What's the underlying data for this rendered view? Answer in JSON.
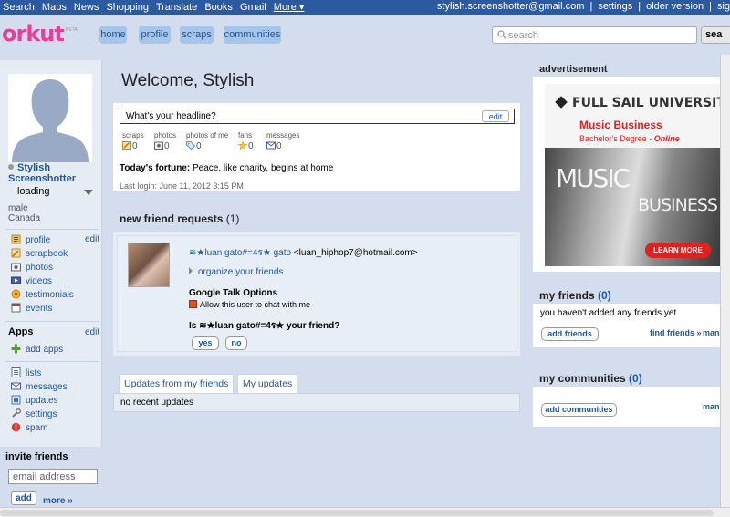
{
  "gbar": {
    "links": [
      "Search",
      "Maps",
      "News",
      "Shopping",
      "Translate",
      "Books",
      "Gmail"
    ],
    "more": "More ▾",
    "email": "stylish.screenshotter@gmail.com",
    "settings": "settings",
    "older_version": "older version",
    "signout": "sig"
  },
  "header": {
    "logo": "orkut",
    "beta": "BETA",
    "nav": [
      "home",
      "profile",
      "scraps",
      "communities"
    ],
    "search_placeholder": "search",
    "search_button": "sea"
  },
  "sidebar": {
    "name": "Stylish Screenshotter",
    "status": "loading",
    "gender": "male",
    "country": "Canada",
    "edit": "edit",
    "items": [
      {
        "label": "profile",
        "icon": "profile-icon"
      },
      {
        "label": "scrapbook",
        "icon": "scrapbook-icon"
      },
      {
        "label": "photos",
        "icon": "photos-icon"
      },
      {
        "label": "videos",
        "icon": "videos-icon"
      },
      {
        "label": "testimonials",
        "icon": "testimonials-icon"
      },
      {
        "label": "events",
        "icon": "events-icon"
      }
    ],
    "apps_title": "Apps",
    "apps_edit": "edit",
    "add_apps": "add apps",
    "tools": [
      {
        "label": "lists",
        "icon": "lists-icon"
      },
      {
        "label": "messages",
        "icon": "messages-icon"
      },
      {
        "label": "updates",
        "icon": "updates-icon"
      },
      {
        "label": "settings",
        "icon": "settings-icon"
      },
      {
        "label": "spam",
        "icon": "spam-icon"
      }
    ],
    "invite_title": "invite friends",
    "invite_placeholder": "email address",
    "add_button": "add",
    "more_link": "more »"
  },
  "main": {
    "welcome": "Welcome, Stylish",
    "headline_placeholder": "What's your headline?",
    "headline_edit": "edit",
    "stats": [
      {
        "label": "scraps",
        "count": "0"
      },
      {
        "label": "photos",
        "count": "0"
      },
      {
        "label": "photos of me",
        "count": "0"
      },
      {
        "label": "fans",
        "count": "0"
      },
      {
        "label": "messages",
        "count": "0"
      }
    ],
    "fortune_label": "Today's fortune:",
    "fortune_text": " Peace, like charity, begins at home",
    "last_login": "Last login: June 11, 2012 3:15 PM"
  },
  "friend_requests": {
    "title": "new friend requests",
    "count": "(1)",
    "name": "≋★luan gato#=4ร★ gato",
    "email": " <luan_hiphop7@hotmail.com>",
    "organize": "organize your friends",
    "gto_title": "Google Talk Options",
    "gto_allow": "Allow this user to chat with me",
    "question": "Is ≋★luan gato#=4ร★ your friend?",
    "yes": "yes",
    "no": "no"
  },
  "updates": {
    "tab1": "Updates from my friends",
    "tab2": "My updates",
    "empty": "no recent updates"
  },
  "right": {
    "ad_title": "advertisement",
    "ad": {
      "brand": "FULL SAIL UNIVERSITY.",
      "program": "Music Business",
      "degree_prefix": "Bachelor's Degree - ",
      "degree_mode": "Online",
      "music": "MUSIC",
      "business": "BUSINESS",
      "cta": "LEARN MORE"
    },
    "friends_title": "my friends",
    "friends_count": "(0)",
    "friends_empty": "you haven't added any friends yet",
    "add_friends": "add friends",
    "find_friends": "find friends »",
    "manage": "mana",
    "communities_title": "my communities",
    "communities_count": "(0)",
    "add_communities": "add communities",
    "manage2": "mana"
  },
  "colors": {
    "accent": "#21569b",
    "logo": "#ea3d9a",
    "background": "#d4ddee",
    "topbar": "#2c5aa0"
  }
}
